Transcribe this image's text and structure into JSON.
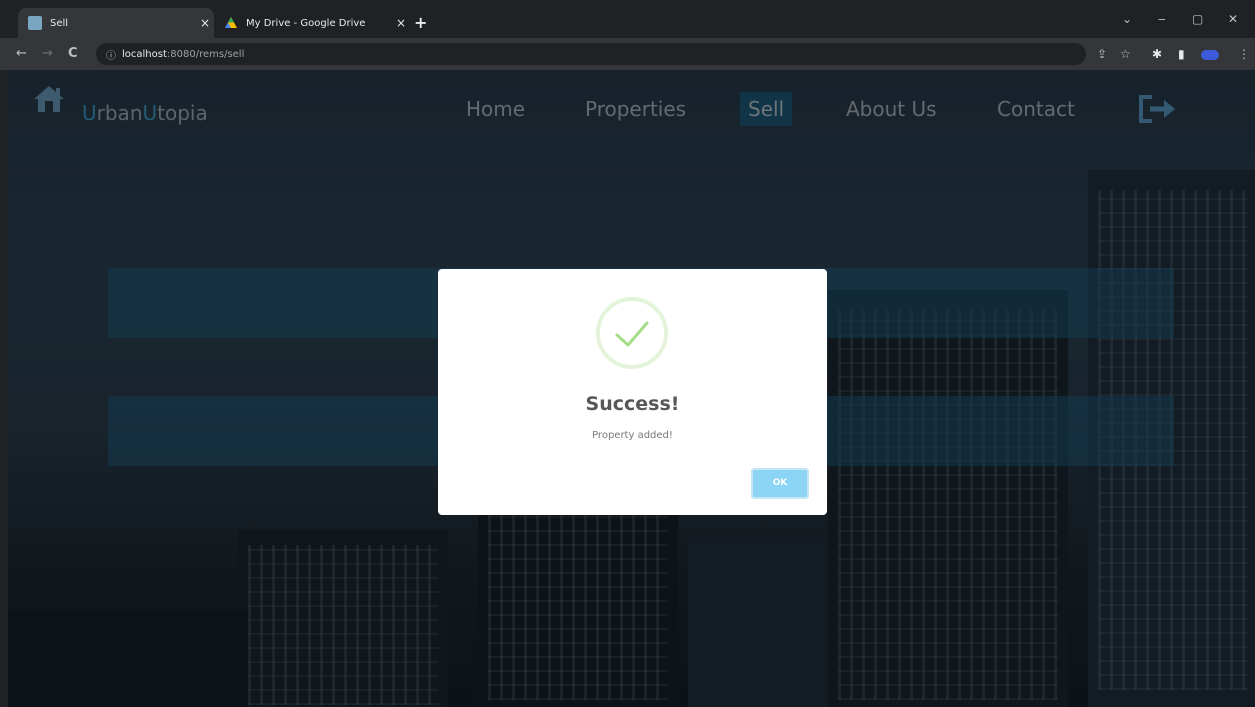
{
  "browser": {
    "tabs": [
      {
        "title": "Sell",
        "active": true
      },
      {
        "title": "My Drive - Google Drive",
        "active": false
      }
    ],
    "new_tab": "+",
    "close_glyph": "×",
    "window_controls": {
      "minimize": "‒",
      "restore": "▢",
      "close": "✕",
      "tabsearch": "⌄"
    },
    "url": {
      "host": "localhost",
      "path": ":8080/rems/sell"
    },
    "nav": {
      "back": "←",
      "forward": "→",
      "reload": "C"
    }
  },
  "site": {
    "brand": {
      "first_initial": "U",
      "first_rest": "rban",
      "second_initial": "U",
      "second_rest": "topia"
    },
    "nav_items": [
      "Home",
      "Properties",
      "Sell",
      "About Us",
      "Contact"
    ],
    "active_nav": "Sell",
    "accent_color": "#3fa7d6"
  },
  "dialog": {
    "title": "Success!",
    "message": "Property added!",
    "button": "OK",
    "icon": "check-icon",
    "icon_color": "#a5dc86",
    "button_color": "#8cd4f5"
  }
}
